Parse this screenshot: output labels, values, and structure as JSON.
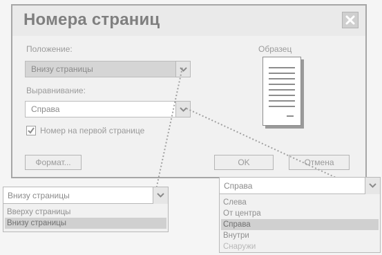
{
  "dialog": {
    "title": "Номера страниц",
    "position_label": "Положение:",
    "position_value": "Внизу страницы",
    "alignment_label": "Выравнивание:",
    "alignment_value": "Справа",
    "checkbox_label": "Номер на первой странице",
    "checkbox_checked": true,
    "preview_label": "Образец",
    "format_button": "Формат...",
    "ok_button": "OK",
    "cancel_button": "Отмена"
  },
  "position_dropdown": {
    "current": "Внизу страницы",
    "options": [
      "Вверху страницы",
      "Внизу страницы"
    ],
    "selected_index": 1
  },
  "alignment_dropdown": {
    "current": "Справа",
    "options": [
      "Слева",
      "От центра",
      "Справа",
      "Внутри",
      "Снаружи"
    ],
    "selected_index": 2
  },
  "icons": {
    "close": "close-icon",
    "dropdown": "chevron-down-icon",
    "check": "check-icon"
  },
  "colors": {
    "dialog_bg": "#f1f1f1",
    "selected_bg": "#d0d0d0",
    "connector": "#a0a0a0"
  }
}
